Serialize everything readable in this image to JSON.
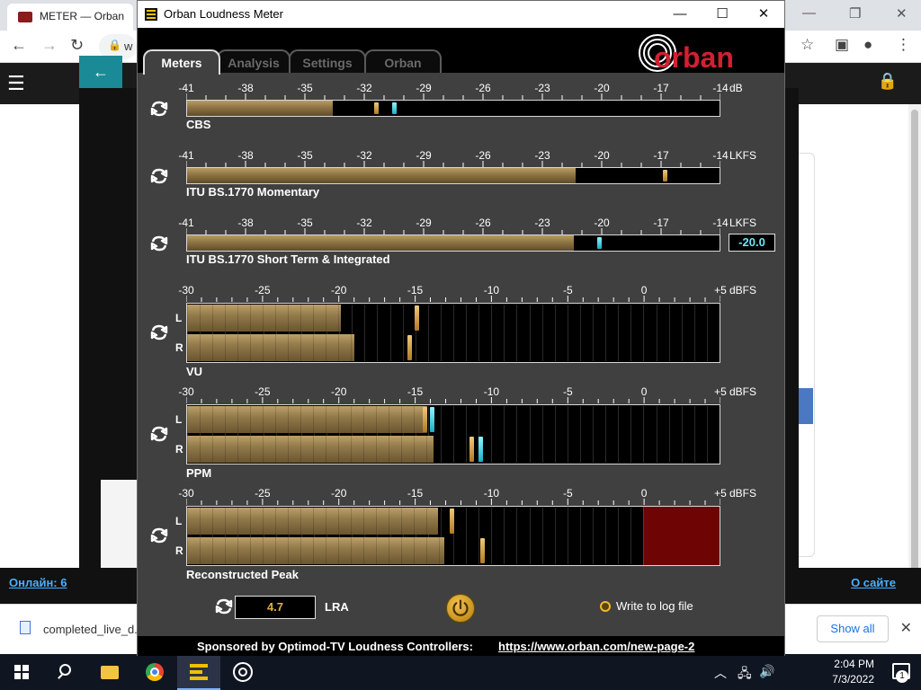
{
  "browser": {
    "tab_title": "METER — Orban",
    "omnibox_text": "w",
    "online_link": "Онлайн: 6",
    "about_link": "О сайте",
    "download_name": "completed_live_d...",
    "show_all": "Show all"
  },
  "taskbar": {
    "time": "2:04 PM",
    "date": "7/3/2022",
    "notifications": "1"
  },
  "window": {
    "title": "Orban Loudness Meter",
    "minimize": "—",
    "maximize": "☐",
    "close": "✕"
  },
  "tabs": [
    {
      "label": "Meters",
      "active": true
    },
    {
      "label": "Analysis",
      "active": false
    },
    {
      "label": "Settings",
      "active": false
    },
    {
      "label": "Orban",
      "active": false
    }
  ],
  "logo_text": "orban",
  "scales": {
    "loudness": {
      "ticks": [
        "-41",
        "-38",
        "-35",
        "-32",
        "-29",
        "-26",
        "-23",
        "-20",
        "-17",
        "-14"
      ],
      "min": -41,
      "max": -14
    },
    "dbfs": {
      "ticks": [
        "-30",
        "-25",
        "-20",
        "-15",
        "-10",
        "-5",
        "0",
        "+5"
      ],
      "min": -30,
      "max": 5
    }
  },
  "meters": [
    {
      "name": "CBS",
      "unit": "dB",
      "scale": "loudness",
      "fill": -33.6,
      "peaks": [
        {
          "v": -31.4,
          "c": "gold"
        },
        {
          "v": -30.5,
          "c": "cyan"
        }
      ]
    },
    {
      "name": "ITU BS.1770 Momentary",
      "unit": "LKFS",
      "scale": "loudness",
      "fill": -21.3,
      "peaks": [
        {
          "v": -16.8,
          "c": "gold"
        }
      ]
    },
    {
      "name": "ITU BS.1770 Short Term & Integrated",
      "unit": "LKFS",
      "scale": "loudness",
      "fill": -21.4,
      "peaks": [
        {
          "v": -20.1,
          "c": "cyan"
        }
      ],
      "value": "-20.0"
    }
  ],
  "stereo_meters": [
    {
      "name": "VU",
      "unit": "dBFS",
      "left": {
        "fill": -19.9,
        "peaks": [
          {
            "v": -14.9,
            "c": "gold"
          }
        ]
      },
      "right": {
        "fill": -19.0,
        "peaks": [
          {
            "v": -15.4,
            "c": "gold"
          }
        ]
      },
      "over": null
    },
    {
      "name": "PPM",
      "unit": "dBFS",
      "left": {
        "fill": -14.2,
        "peaks": [
          {
            "v": -14.4,
            "c": "gold"
          },
          {
            "v": -13.9,
            "c": "cyan"
          }
        ]
      },
      "right": {
        "fill": -13.8,
        "peaks": [
          {
            "v": -11.3,
            "c": "gold"
          },
          {
            "v": -10.7,
            "c": "cyan"
          }
        ]
      },
      "over": null
    },
    {
      "name": "Reconstructed Peak",
      "unit": "dBFS",
      "left": {
        "fill": -13.5,
        "peaks": [
          {
            "v": -12.6,
            "c": "gold"
          }
        ]
      },
      "right": {
        "fill": -13.1,
        "peaks": [
          {
            "v": -10.6,
            "c": "gold"
          }
        ]
      },
      "over": 0
    }
  ],
  "channel_labels": {
    "left": "L",
    "right": "R"
  },
  "lra": {
    "value": "4.7",
    "label": "LRA"
  },
  "log_file_label": "Write to log file",
  "sponsor": {
    "text": "Sponsored by Optimod-TV Loudness Controllers:",
    "link": "https://www.orban.com/new-page-2"
  },
  "colors": {
    "accent_gold": "#e0b040",
    "peak_cyan": "#6fe6f0",
    "panel_gray": "#404040",
    "over_red": "#6e0404"
  }
}
